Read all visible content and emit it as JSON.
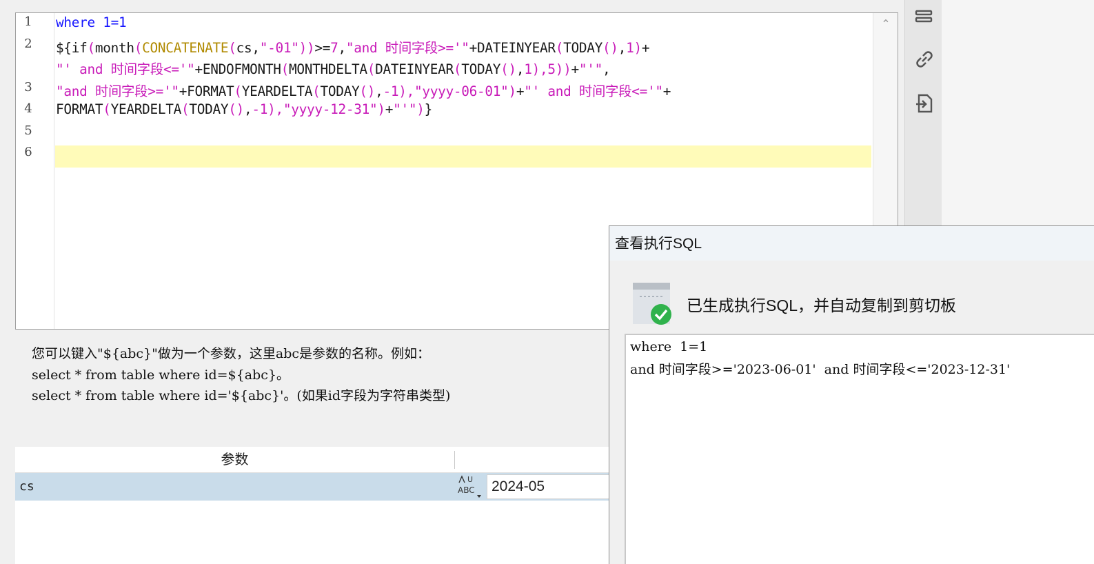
{
  "editor": {
    "line_numbers": [
      "1",
      "2",
      "",
      "3",
      "4",
      "5",
      "6"
    ],
    "lines": [
      [
        {
          "t": "where",
          "c": "kw"
        },
        {
          "t": " "
        },
        {
          "t": "1=1",
          "c": "kw"
        }
      ],
      [
        {
          "t": "${if"
        },
        {
          "t": "(",
          "c": "str"
        },
        {
          "t": "month"
        },
        {
          "t": "(",
          "c": "str"
        },
        {
          "t": "CONCATENATE",
          "c": "fn"
        },
        {
          "t": "(",
          "c": "str"
        },
        {
          "t": "cs,"
        },
        {
          "t": "\"-01\"",
          "c": "str"
        },
        {
          "t": "))",
          "c": "str"
        },
        {
          "t": ">="
        },
        {
          "t": "7",
          "c": "num"
        },
        {
          "t": ","
        },
        {
          "t": "\"and 时间字段>='\"",
          "c": "str"
        },
        {
          "t": "+DATEINYEAR"
        },
        {
          "t": "(",
          "c": "str"
        },
        {
          "t": "TODAY"
        },
        {
          "t": "()",
          "c": "str"
        },
        {
          "t": ","
        },
        {
          "t": "1",
          "c": "num"
        },
        {
          "t": ")",
          "c": "str"
        },
        {
          "t": "+"
        }
      ],
      [
        {
          "t": "\"' and 时间字段<='\"",
          "c": "str"
        },
        {
          "t": "+ENDOFMONTH"
        },
        {
          "t": "(",
          "c": "str"
        },
        {
          "t": "MONTHDELTA"
        },
        {
          "t": "(",
          "c": "str"
        },
        {
          "t": "DATEINYEAR"
        },
        {
          "t": "(",
          "c": "str"
        },
        {
          "t": "TODAY"
        },
        {
          "t": "()",
          "c": "str"
        },
        {
          "t": ","
        },
        {
          "t": "1",
          "c": "num"
        },
        {
          "t": "),",
          "c": "str"
        },
        {
          "t": "5",
          "c": "num"
        },
        {
          "t": "))",
          "c": "str"
        },
        {
          "t": "+"
        },
        {
          "t": "\"'\"",
          "c": "str"
        },
        {
          "t": ","
        }
      ],
      [
        {
          "t": "\"and 时间字段>='\"",
          "c": "str"
        },
        {
          "t": "+FORMAT"
        },
        {
          "t": "(",
          "c": "str"
        },
        {
          "t": "YEARDELTA"
        },
        {
          "t": "(",
          "c": "str"
        },
        {
          "t": "TODAY"
        },
        {
          "t": "()",
          "c": "str"
        },
        {
          "t": ","
        },
        {
          "t": "-1",
          "c": "num"
        },
        {
          "t": "),",
          "c": "str"
        },
        {
          "t": "\"yyyy-06-01\"",
          "c": "str"
        },
        {
          "t": ")",
          "c": "str"
        },
        {
          "t": "+"
        },
        {
          "t": "\"' and 时间字段<='\"",
          "c": "str"
        },
        {
          "t": "+"
        }
      ],
      [
        {
          "t": "FORMAT"
        },
        {
          "t": "(",
          "c": "str"
        },
        {
          "t": "YEARDELTA"
        },
        {
          "t": "(",
          "c": "str"
        },
        {
          "t": "TODAY"
        },
        {
          "t": "()",
          "c": "str"
        },
        {
          "t": ","
        },
        {
          "t": "-1",
          "c": "num"
        },
        {
          "t": "),",
          "c": "str"
        },
        {
          "t": "\"yyyy-12-31\"",
          "c": "str"
        },
        {
          "t": ")",
          "c": "str"
        },
        {
          "t": "+"
        },
        {
          "t": "\"'\"",
          "c": "str"
        },
        {
          "t": ")",
          "c": "str"
        },
        {
          "t": "}"
        }
      ],
      [],
      []
    ]
  },
  "help": {
    "line1": "您可以键入\"${abc}\"做为一个参数，这里abc是参数的名称。例如：",
    "line2": "select * from table where id=${abc}。",
    "line3": "select * from table where id='${abc}'。(如果id字段为字符串类型)"
  },
  "params": {
    "header": "参数",
    "rows": [
      {
        "name": "cs",
        "type_label": "ABC",
        "value": "2024-05"
      }
    ]
  },
  "dialog": {
    "title": "查看执行SQL",
    "message": "已生成执行SQL，并自动复制到剪切板",
    "sql_lines": [
      "where  1=1",
      "and 时间字段>='2023-06-01'  and 时间字段<='2023-12-31'"
    ]
  },
  "tools": [
    "list-icon",
    "link-icon",
    "import-icon"
  ],
  "colors": {
    "keyword": "#1515ff",
    "string": "#c81ab8",
    "function": "#b08a00",
    "current_line": "#fffbb9",
    "selected_row": "#c9dcea"
  }
}
